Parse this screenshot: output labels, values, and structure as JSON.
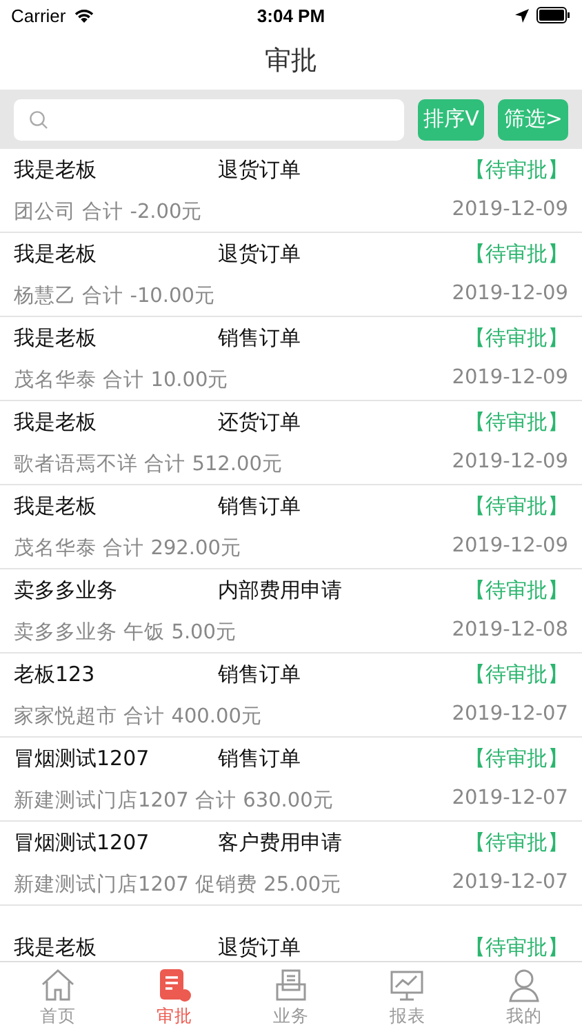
{
  "status_bar": {
    "carrier": "Carrier",
    "time": "3:04 PM"
  },
  "nav": {
    "title": "审批"
  },
  "search": {
    "sort_button": "排序V",
    "filter_button": "筛选>"
  },
  "orders": [
    {
      "person": "我是老板",
      "type": "退货订单",
      "status": "【待审批】",
      "detail": "团公司  合计 -2.00元",
      "date": "2019-12-09"
    },
    {
      "person": "我是老板",
      "type": "退货订单",
      "status": "【待审批】",
      "detail": "杨慧乙  合计 -10.00元",
      "date": "2019-12-09"
    },
    {
      "person": "我是老板",
      "type": "销售订单",
      "status": "【待审批】",
      "detail": "茂名华泰  合计 10.00元",
      "date": "2019-12-09"
    },
    {
      "person": "我是老板",
      "type": "还货订单",
      "status": "【待审批】",
      "detail": "歌者语焉不详  合计 512.00元",
      "date": "2019-12-09"
    },
    {
      "person": "我是老板",
      "type": "销售订单",
      "status": "【待审批】",
      "detail": "茂名华泰  合计 292.00元",
      "date": "2019-12-09"
    },
    {
      "person": "卖多多业务",
      "type": "内部费用申请",
      "status": "【待审批】",
      "detail": "卖多多业务  午饭 5.00元",
      "date": "2019-12-08"
    },
    {
      "person": "老板123",
      "type": "销售订单",
      "status": "【待审批】",
      "detail": "家家悦超市  合计 400.00元",
      "date": "2019-12-07"
    },
    {
      "person": "冒烟测试1207",
      "type": "销售订单",
      "status": "【待审批】",
      "detail": "新建测试门店1207  合计 630.00元",
      "date": "2019-12-07"
    },
    {
      "person": "冒烟测试1207",
      "type": "客户费用申请",
      "status": "【待审批】",
      "detail": "新建测试门店1207  促销费 25.00元",
      "date": "2019-12-07"
    },
    {
      "person": "我是老板",
      "type": "退货订单",
      "status": "【待审批】"
    }
  ],
  "tabs": [
    {
      "label": "首页",
      "kind": "home",
      "selected": false
    },
    {
      "label": "审批",
      "kind": "approve",
      "selected": true
    },
    {
      "label": "业务",
      "kind": "business",
      "selected": false
    },
    {
      "label": "报表",
      "kind": "report",
      "selected": false
    },
    {
      "label": "我的",
      "kind": "me",
      "selected": false
    }
  ]
}
